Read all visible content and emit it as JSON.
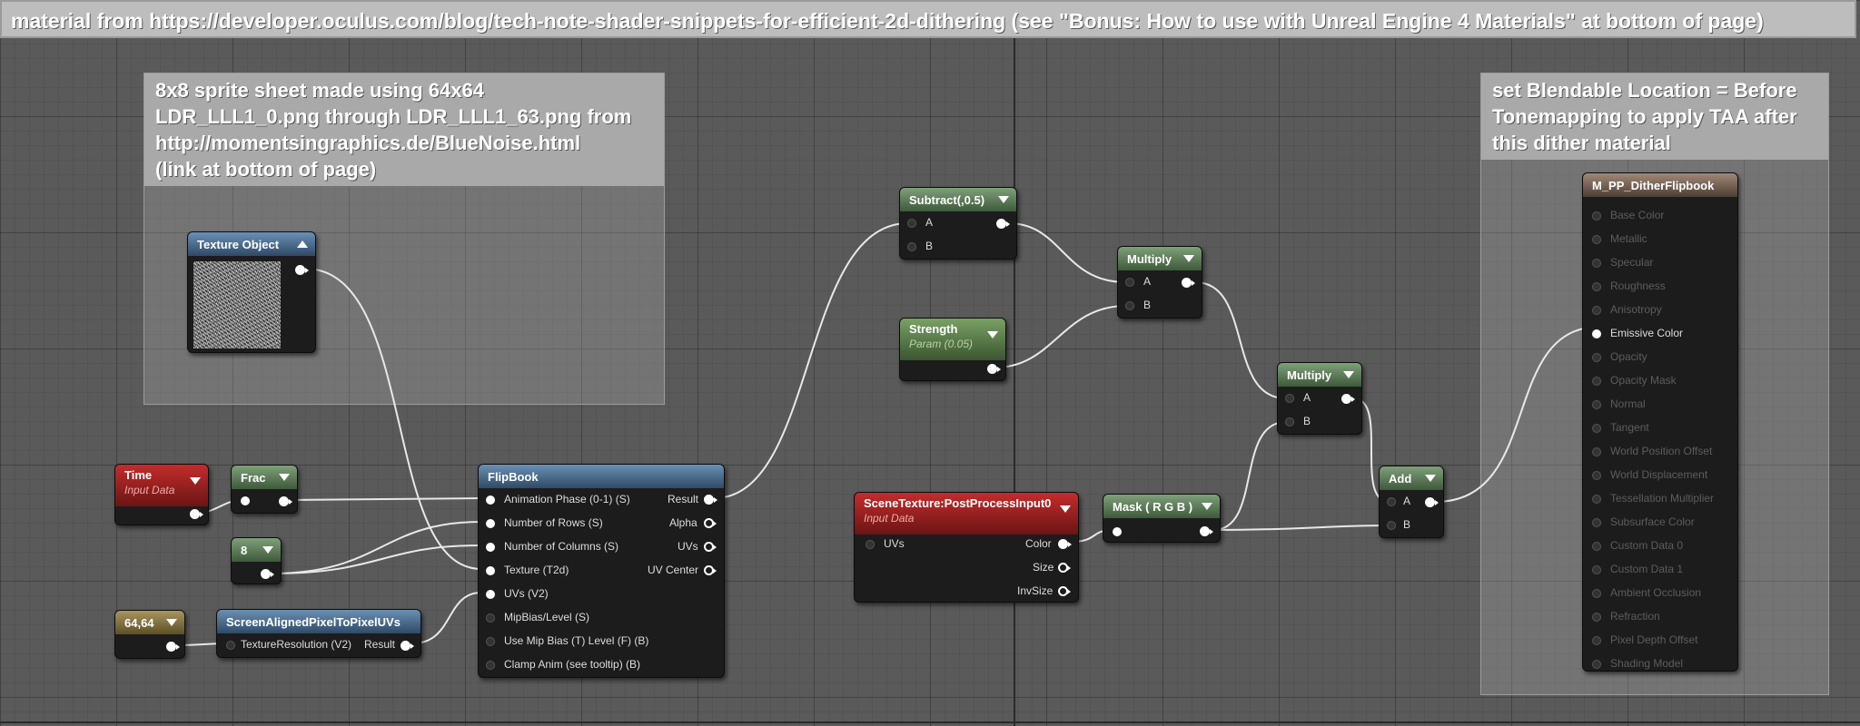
{
  "comments": {
    "top": "material from https://developer.oculus.com/blog/tech-note-shader-snippets-for-efficient-2d-dithering (see \"Bonus: How to use with Unreal Engine 4 Materials\" at bottom of page)",
    "spritesheet": "8x8 sprite sheet made using 64x64\nLDR_LLL1_0.png through LDR_LLL1_63.png from\nhttp://momentsingraphics.de/BlueNoise.html\n(link at bottom of page)",
    "blendable": "set Blendable Location = Before\nTonemapping to apply TAA after\nthis dither material"
  },
  "nodes": {
    "texture_object": {
      "title": "Texture Object"
    },
    "time": {
      "title": "Time",
      "subtitle": "Input Data"
    },
    "frac": {
      "title": "Frac"
    },
    "const_8": {
      "title": "8"
    },
    "const_64": {
      "title": "64,64"
    },
    "screen_aligned": {
      "title": "ScreenAlignedPixelToPixelUVs",
      "in": "TextureResolution (V2)",
      "out": "Result"
    },
    "flipbook": {
      "title": "FlipBook",
      "inputs": [
        "Animation  Phase (0-1) (S)",
        "Number of Rows (S)",
        "Number of Columns (S)",
        "Texture (T2d)",
        "UVs (V2)",
        "MipBias/Level (S)",
        "Use Mip Bias (T) Level (F) (B)",
        "Clamp Anim (see tooltip) (B)"
      ],
      "outputs": [
        "Result",
        "Alpha",
        "UVs",
        "UV Center"
      ]
    },
    "subtract": {
      "title": "Subtract(,0.5)",
      "inputs": [
        "A",
        "B"
      ]
    },
    "strength": {
      "title": "Strength",
      "subtitle": "Param (0.05)"
    },
    "multiply1": {
      "title": "Multiply",
      "inputs": [
        "A",
        "B"
      ]
    },
    "scene_texture": {
      "title": "SceneTexture:PostProcessInput0",
      "subtitle": "Input Data",
      "in": "UVs",
      "outputs": [
        "Color",
        "Size",
        "InvSize"
      ]
    },
    "mask": {
      "title": "Mask ( R G B )"
    },
    "multiply2": {
      "title": "Multiply",
      "inputs": [
        "A",
        "B"
      ]
    },
    "add": {
      "title": "Add",
      "inputs": [
        "A",
        "B"
      ]
    },
    "result": {
      "title": "M_PP_DitherFlipbook",
      "inputs": [
        "Base Color",
        "Metallic",
        "Specular",
        "Roughness",
        "Anisotropy",
        "Emissive Color",
        "Opacity",
        "Opacity Mask",
        "Normal",
        "Tangent",
        "World Position Offset",
        "World Displacement",
        "Tessellation Multiplier",
        "Subsurface Color",
        "Custom Data 0",
        "Custom Data 1",
        "Ambient Occlusion",
        "Refraction",
        "Pixel Depth Offset",
        "Shading Model"
      ]
    }
  },
  "colors": {
    "canvas": "#5a5a5a",
    "active_pin": "#ffffff",
    "inactive_pin_text": "#5d5d5d"
  }
}
